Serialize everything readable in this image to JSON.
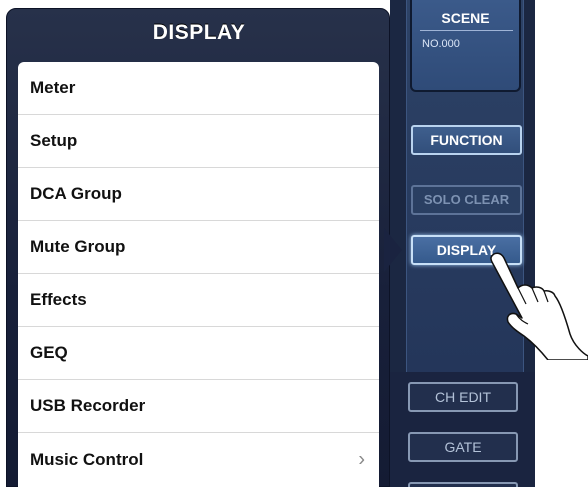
{
  "popover": {
    "title": "DISPLAY",
    "items": [
      {
        "label": "Meter"
      },
      {
        "label": "Setup"
      },
      {
        "label": "DCA Group"
      },
      {
        "label": "Mute Group"
      },
      {
        "label": "Effects"
      },
      {
        "label": "GEQ"
      },
      {
        "label": "USB Recorder"
      },
      {
        "label": "Music Control",
        "chevron": "›"
      }
    ]
  },
  "side_panel": {
    "scene": {
      "label": "SCENE",
      "number": "NO.000"
    },
    "buttons": {
      "function": "FUNCTION",
      "solo_clear": "SOLO CLEAR",
      "display": "DISPLAY",
      "ch_edit": "CH EDIT",
      "gate": "GATE"
    }
  },
  "colors": {
    "popover_bg": "#1b233d",
    "panel_bg": "#1b2742",
    "active_button_border": "#c8e0f7"
  },
  "icons": {
    "pointer": "hand-pointer-icon"
  }
}
